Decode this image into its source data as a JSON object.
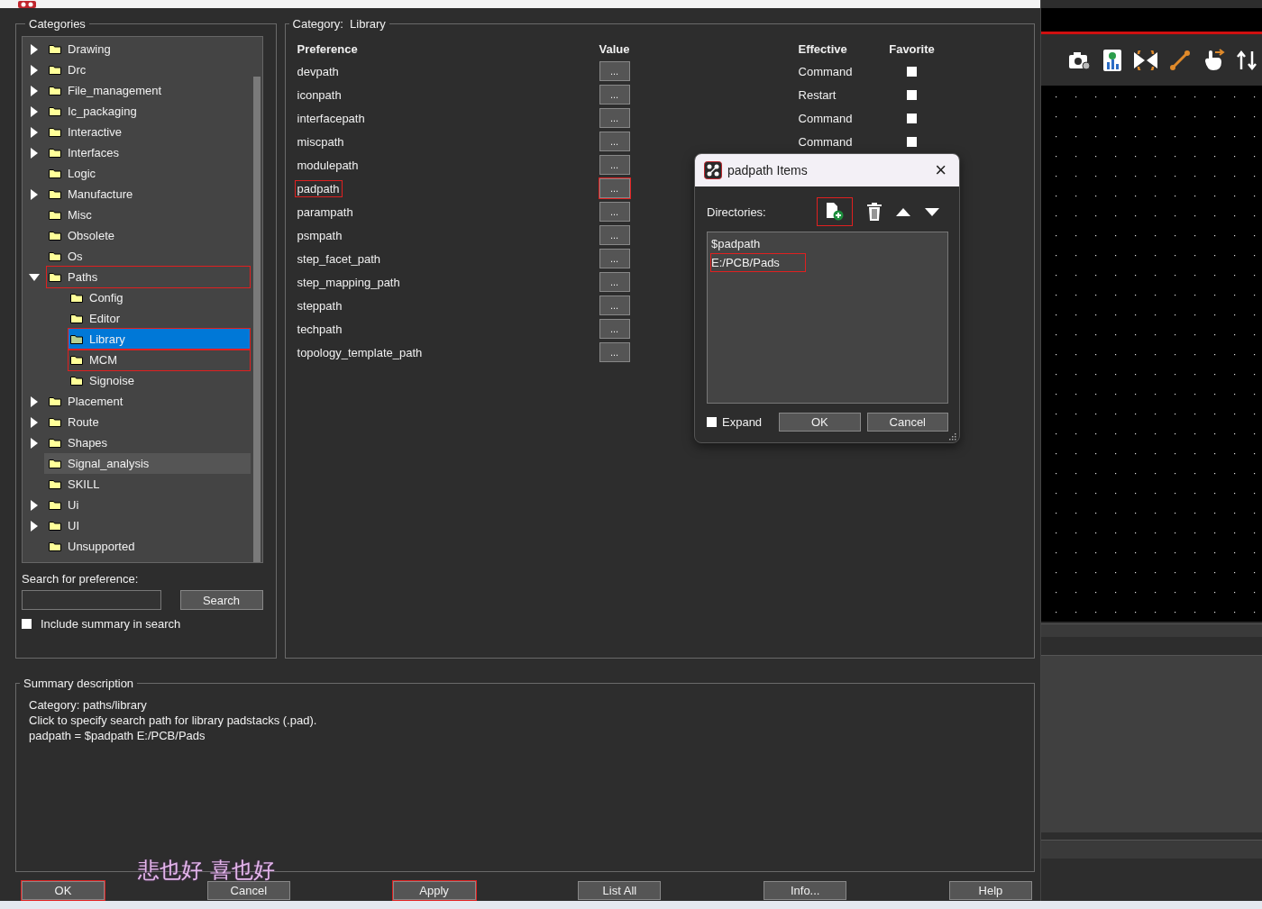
{
  "categories": {
    "title": "Categories",
    "tree": [
      {
        "label": "Drawing",
        "expandable": true,
        "expanded": false,
        "selected": false,
        "hovered": false,
        "marked": false
      },
      {
        "label": "Drc",
        "expandable": true,
        "expanded": false,
        "selected": false,
        "hovered": false,
        "marked": false
      },
      {
        "label": "File_management",
        "expandable": true,
        "expanded": false,
        "selected": false,
        "hovered": false,
        "marked": false
      },
      {
        "label": "Ic_packaging",
        "expandable": true,
        "expanded": false,
        "selected": false,
        "hovered": false,
        "marked": false
      },
      {
        "label": "Interactive",
        "expandable": true,
        "expanded": false,
        "selected": false,
        "hovered": false,
        "marked": false
      },
      {
        "label": "Interfaces",
        "expandable": true,
        "expanded": false,
        "selected": false,
        "hovered": false,
        "marked": false
      },
      {
        "label": "Logic",
        "expandable": false,
        "selected": false,
        "hovered": false,
        "marked": false
      },
      {
        "label": "Manufacture",
        "expandable": true,
        "expanded": false,
        "selected": false,
        "hovered": false,
        "marked": false
      },
      {
        "label": "Misc",
        "expandable": false,
        "selected": false,
        "hovered": false,
        "marked": false
      },
      {
        "label": "Obsolete",
        "expandable": false,
        "selected": false,
        "hovered": false,
        "marked": false
      },
      {
        "label": "Os",
        "expandable": false,
        "selected": false,
        "hovered": false,
        "marked": false
      },
      {
        "label": "Paths",
        "expandable": true,
        "expanded": true,
        "selected": false,
        "hovered": false,
        "marked": true,
        "children": [
          {
            "label": "Config",
            "selected": false,
            "hovered": false,
            "marked": false
          },
          {
            "label": "Editor",
            "selected": false,
            "hovered": false,
            "marked": false
          },
          {
            "label": "Library",
            "selected": true,
            "hovered": false,
            "marked": true
          },
          {
            "label": "MCM",
            "selected": false,
            "hovered": false,
            "marked": true
          },
          {
            "label": "Signoise",
            "selected": false,
            "hovered": false,
            "marked": false
          }
        ]
      },
      {
        "label": "Placement",
        "expandable": true,
        "expanded": false,
        "selected": false,
        "hovered": false,
        "marked": false
      },
      {
        "label": "Route",
        "expandable": true,
        "expanded": false,
        "selected": false,
        "hovered": false,
        "marked": false
      },
      {
        "label": "Shapes",
        "expandable": true,
        "expanded": false,
        "selected": false,
        "hovered": false,
        "marked": false
      },
      {
        "label": "Signal_analysis",
        "expandable": false,
        "selected": false,
        "hovered": true,
        "marked": false
      },
      {
        "label": "SKILL",
        "expandable": false,
        "selected": false,
        "hovered": false,
        "marked": false
      },
      {
        "label": "Ui",
        "expandable": true,
        "expanded": false,
        "selected": false,
        "hovered": false,
        "marked": false
      },
      {
        "label": "UI",
        "expandable": true,
        "expanded": false,
        "selected": false,
        "hovered": false,
        "marked": false
      },
      {
        "label": "Unsupported",
        "expandable": false,
        "selected": false,
        "hovered": false,
        "marked": false
      }
    ],
    "search_label": "Search for preference:",
    "search_button": "Search",
    "include_summary": {
      "label": "Include summary in search",
      "checked": false
    }
  },
  "category": {
    "label": "Category:",
    "value": "Library",
    "columns": [
      "Preference",
      "Value",
      "Effective",
      "Favorite"
    ],
    "rows": [
      {
        "name": "devpath",
        "button": "...",
        "effective": "Command",
        "favorite": false,
        "marked": false
      },
      {
        "name": "iconpath",
        "button": "...",
        "effective": "Restart",
        "favorite": false,
        "marked": false
      },
      {
        "name": "interfacepath",
        "button": "...",
        "effective": "Command",
        "favorite": false,
        "marked": false
      },
      {
        "name": "miscpath",
        "button": "...",
        "effective": "Command",
        "favorite": false,
        "marked": false
      },
      {
        "name": "modulepath",
        "button": "...",
        "marked": false
      },
      {
        "name": "padpath",
        "button": "...",
        "marked": true
      },
      {
        "name": "parampath",
        "button": "...",
        "marked": false
      },
      {
        "name": "psmpath",
        "button": "...",
        "marked": false
      },
      {
        "name": "step_facet_path",
        "button": "...",
        "marked": false
      },
      {
        "name": "step_mapping_path",
        "button": "...",
        "marked": false
      },
      {
        "name": "steppath",
        "button": "...",
        "marked": false
      },
      {
        "name": "techpath",
        "button": "...",
        "marked": false
      },
      {
        "name": "topology_template_path",
        "button": "...",
        "marked": false
      }
    ]
  },
  "summary": {
    "title": "Summary description",
    "lines": [
      "Category: paths/library",
      "Click to specify search path for library padstacks (.pad).",
      "padpath = $padpath E:/PCB/Pads"
    ]
  },
  "buttons": [
    {
      "label": "OK",
      "marked": true
    },
    {
      "label": "Cancel",
      "marked": false
    },
    {
      "label": "Apply",
      "marked": true
    },
    {
      "label": "List All",
      "marked": false
    },
    {
      "label": "Info...",
      "marked": false
    },
    {
      "label": "Help",
      "marked": false
    }
  ],
  "popup": {
    "title": "padpath Items",
    "close": "×",
    "directories_label": "Directories:",
    "new_marked": true,
    "items": [
      {
        "text": "$padpath",
        "marked": false
      },
      {
        "text": "E:/PCB/Pads",
        "marked": true
      }
    ],
    "expand": {
      "label": "Expand",
      "checked": false
    },
    "buttons": [
      "OK",
      "Cancel"
    ]
  },
  "lyrics": "悲也好 喜也好"
}
